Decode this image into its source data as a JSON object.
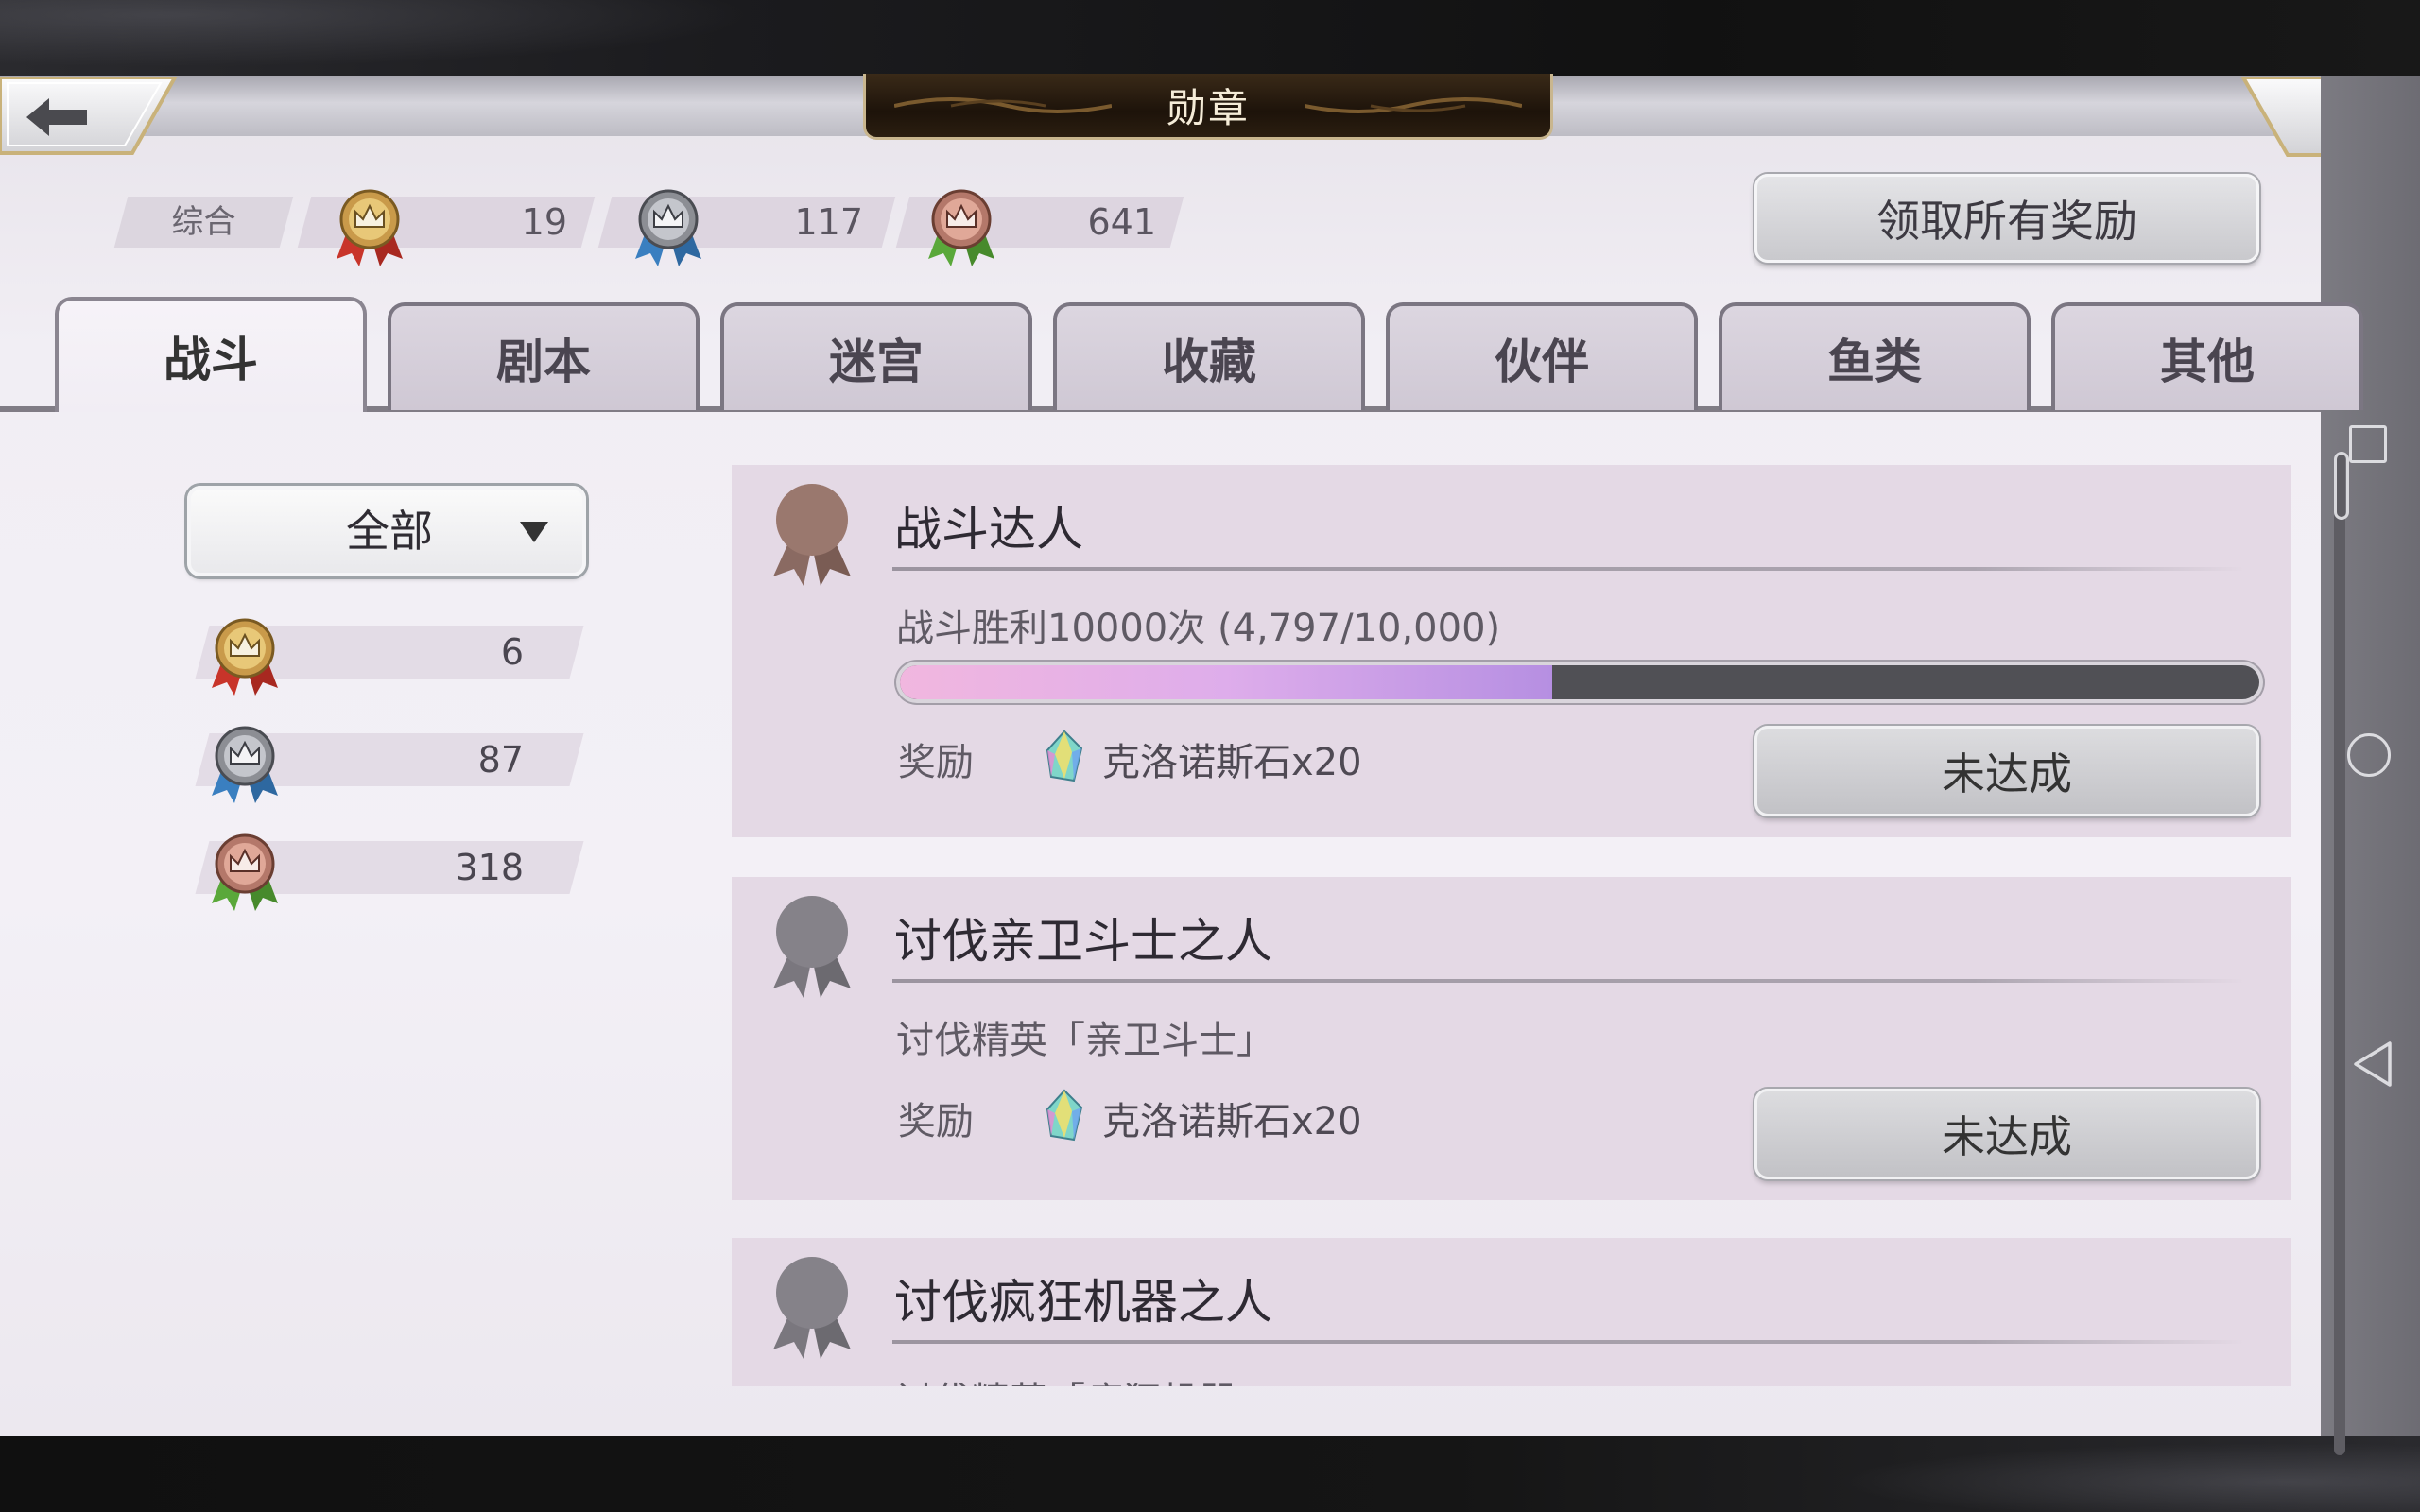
{
  "header": {
    "title": "勋章"
  },
  "summary": {
    "label": "综合",
    "gold": "19",
    "silver": "117",
    "bronze": "641"
  },
  "claim_all_label": "领取所有奖励",
  "tabs": [
    {
      "label": "战斗",
      "active": true
    },
    {
      "label": "剧本",
      "active": false
    },
    {
      "label": "迷宫",
      "active": false
    },
    {
      "label": "收藏",
      "active": false
    },
    {
      "label": "伙伴",
      "active": false
    },
    {
      "label": "鱼类",
      "active": false
    },
    {
      "label": "其他",
      "active": false
    }
  ],
  "filter": {
    "selected": "全部"
  },
  "sidebar_counts": {
    "gold": "6",
    "silver": "87",
    "bronze": "318"
  },
  "colors": {
    "gold_ribbon": "#c8342a",
    "silver_ribbon": "#3a7fc0",
    "bronze_ribbon": "#5aa83a",
    "progress_fill": "#d9a6e6"
  },
  "achievements": [
    {
      "title": "战斗达人",
      "description": "战斗胜利10000次 (4,797/10,000)",
      "progress": 0.4797,
      "reward_label": "奖励",
      "reward": "克洛诺斯石x20",
      "status": "未达成",
      "medal_tier": "bronze"
    },
    {
      "title": "讨伐亲卫斗士之人",
      "description": "讨伐精英「亲卫斗士」",
      "reward_label": "奖励",
      "reward": "克洛诺斯石x20",
      "status": "未达成",
      "medal_tier": "locked"
    },
    {
      "title": "讨伐疯狂机器之人",
      "description": "讨伐精英「疯狂机器",
      "medal_tier": "locked"
    }
  ],
  "icons": {
    "back": "arrow-left-icon",
    "close": "close-x-icon",
    "crystal": "chronos-stone-icon",
    "nav_square": "recent-apps-icon",
    "nav_circle": "home-icon",
    "nav_triangle": "back-nav-icon"
  }
}
